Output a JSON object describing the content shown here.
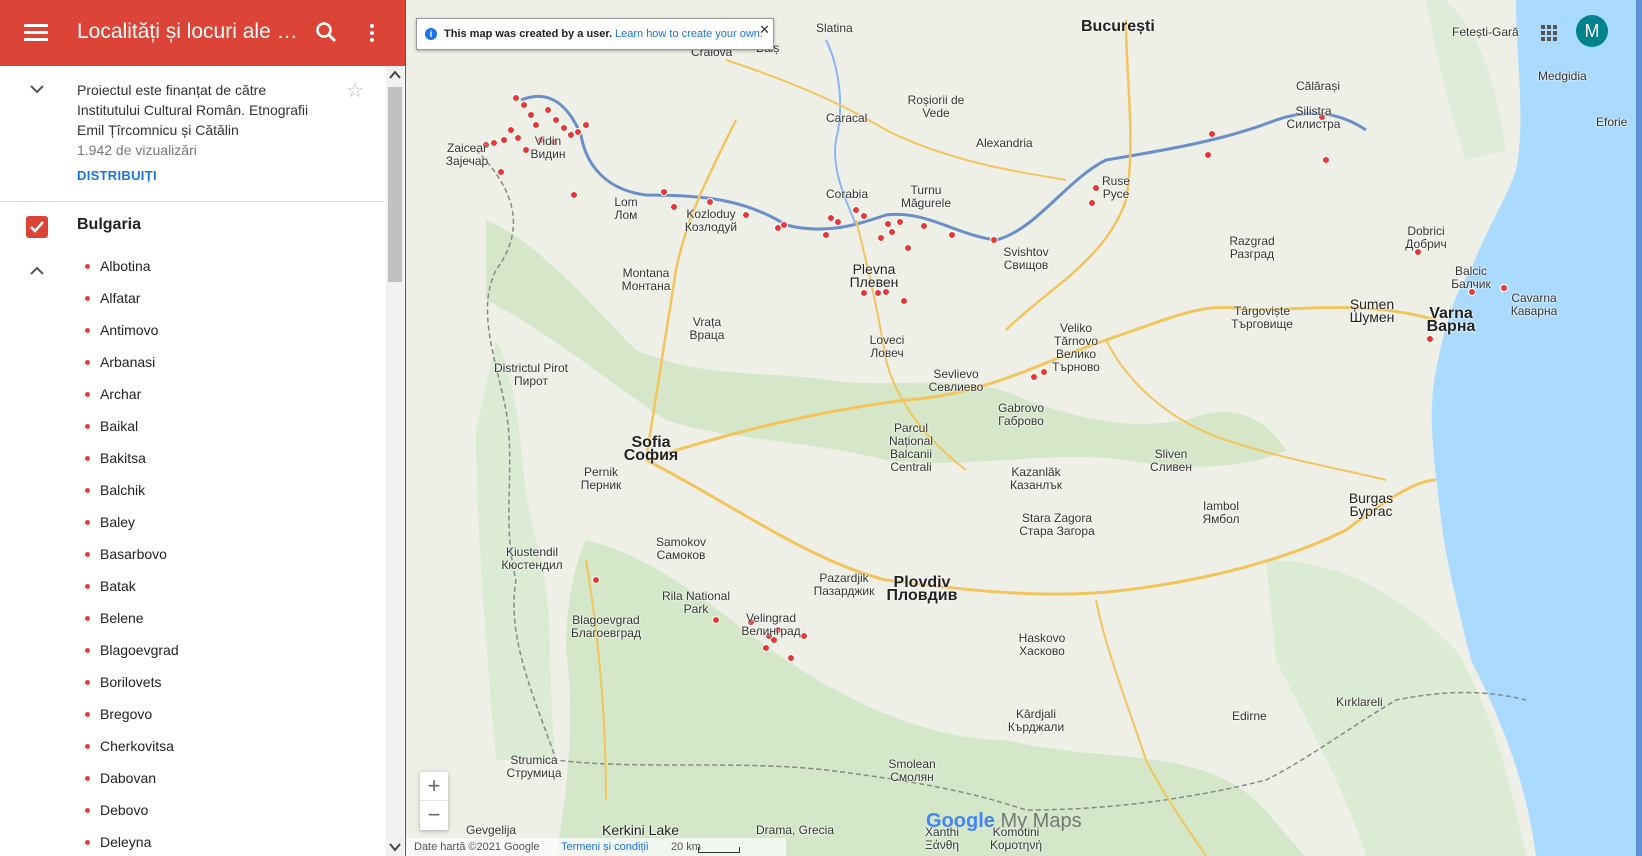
{
  "header": {
    "title": "Localități și locuri ale m...",
    "colors": {
      "bar": "#db4437",
      "text": "#ffffff"
    }
  },
  "description": {
    "text": "Proiectul este finanțat de către Institutului Cultural Român. Etnografii Emil Țîrcomnicu și Cătălin",
    "views": "1.942 de vizualizări",
    "share": "DISTRIBUIȚI"
  },
  "layer": {
    "name": "Bulgaria",
    "checked": true,
    "places": [
      "Albotina",
      "Alfatar",
      "Antimovo",
      "Arbanasi",
      "Archar",
      "Baikal",
      "Bakitsa",
      "Balchik",
      "Baley",
      "Basarbovo",
      "Batak",
      "Belene",
      "Blagoevgrad",
      "Borilovets",
      "Bregovo",
      "Cherkovitsa",
      "Dabovan",
      "Debovo",
      "Deleyna"
    ]
  },
  "map": {
    "notice": {
      "text": "This map was created by a user.",
      "link": "Learn how to create your own."
    },
    "avatar_letter": "M",
    "zoom_in": "+",
    "zoom_out": "−",
    "brand_google": "Google",
    "brand_mymaps": "My Maps",
    "footer": {
      "attribution": "Date hartă ©2021 Google",
      "terms": "Termeni și condiții",
      "scale": "20 km"
    },
    "labels": {
      "bucuresti": "București",
      "craiova": "Craiova",
      "slatina": "Slatina",
      "bals": "Balș",
      "caracal": "Caracal",
      "rosiori": "Roșiorii de Vede",
      "alexandria": "Alexandria",
      "calarasi": "Călărași",
      "silistra": "Silistra Силистра",
      "ruse": "Ruse Русе",
      "vidin": "Vidin Видин",
      "zaicear": "Zaicear Зајечар",
      "lom": "Lom Лом",
      "kozloduy": "Kozloduy Козлодуй",
      "corabia": "Corabia",
      "turnu": "Turnu Măgurele",
      "svistov": "Svishtov Свищов",
      "montana": "Montana Монтана",
      "pleven": "Plevna Плевен",
      "vratsa": "Vrața Враца",
      "lovech": "Loveci Ловеч",
      "veliko": "Veliko Tărnovo Велико Търново",
      "razgrad": "Razgrad Разград",
      "shumen": "Șumen Шумен",
      "targoviste": "Târgoviște Търговище",
      "dobrich": "Dobrici Добрич",
      "varna": "Varna Варна",
      "balchik": "Balcic Балчик",
      "kavarna": "Cavarna Каварна",
      "sofia": "Sofia София",
      "pernik": "Pernik Перник",
      "pirot": "Districtul Pirot Пирот",
      "gabrovo": "Gabrovo Габрово",
      "sevlievo": "Sevlievo Севлиево",
      "kazanlak": "Kazanlăk Казанлък",
      "sliven": "Sliven Сливен",
      "burgas": "Burgas Бургас",
      "yambol": "Iambol Ямбол",
      "starazagora": "Stara Zagora Стара Загора",
      "plovdiv": "Plovdiv Пловдив",
      "pazardzhik": "Pazardjik Пазарджик",
      "haskovo": "Haskovo Хасково",
      "kardzhali": "Kârdjali Кърджали",
      "smolyan": "Smolean Смолян",
      "blagoevgrad": "Blagoevgrad Благоевград",
      "kyustendil": "Kiustendil Кюстендил",
      "velingrad": "Velingrad Велинград",
      "samokov": "Samokov Самоков",
      "rila": "Rila National Park",
      "balcani": "Parcul Național Balcanii Centrali",
      "edirne": "Edirne",
      "kirklareli": "Kırklareli",
      "drama": "Drama, Grecia",
      "xanthi": "Xanthi Ξάνθη",
      "komotini": "Komotini Κομοτηνή",
      "strumica": "Strumica Струмица",
      "gevgelija": "Gevgelija",
      "kerkini": "Kerkini Lake",
      "medgidia": "Medgidia",
      "eforie": "Eforie",
      "fetesti": "Fetești-Gară"
    }
  }
}
